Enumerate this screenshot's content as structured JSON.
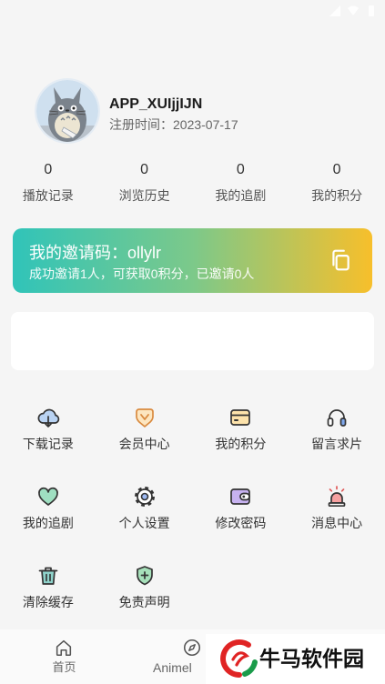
{
  "colors": {
    "background": "#f5f5f5",
    "card": "#ffffff",
    "text_primary": "#222222",
    "text_secondary": "#666666",
    "invite_gradient_start": "#30c4b9",
    "invite_gradient_end": "#f7bf2b",
    "nav_background": "#fafafa"
  },
  "status_bar": {
    "icons": [
      "signal-icon",
      "wifi-icon",
      "battery-icon"
    ]
  },
  "profile": {
    "avatar": "totoro-avatar",
    "username": "APP_XUIjjIJN",
    "register_time": "注册时间：2023-07-17"
  },
  "stats": [
    {
      "value": 0,
      "label": "播放记录"
    },
    {
      "value": 0,
      "label": "浏览历史"
    },
    {
      "value": 0,
      "label": "我的追剧"
    },
    {
      "value": 0,
      "label": "我的积分"
    }
  ],
  "invite": {
    "title": "我的邀请码：ollylr",
    "subtitle": "成功邀请1人，可获取0积分，已邀请0人",
    "icon": "copy-icon"
  },
  "menu": [
    {
      "label": "下载记录",
      "icon": "cloud-download-icon"
    },
    {
      "label": "会员中心",
      "icon": "vip-badge-icon"
    },
    {
      "label": "我的积分",
      "icon": "points-card-icon"
    },
    {
      "label": "留言求片",
      "icon": "headphones-icon"
    },
    {
      "label": "我的追剧",
      "icon": "heart-icon"
    },
    {
      "label": "个人设置",
      "icon": "gear-icon"
    },
    {
      "label": "修改密码",
      "icon": "wallet-icon"
    },
    {
      "label": "消息中心",
      "icon": "alarm-icon"
    },
    {
      "label": "清除缓存",
      "icon": "trash-icon"
    },
    {
      "label": "免责声明",
      "icon": "shield-plus-icon"
    }
  ],
  "bottom_nav": [
    {
      "label": "首页",
      "icon": "home-icon"
    },
    {
      "label": "Animel",
      "icon": "compass-icon"
    }
  ],
  "watermark": {
    "text": "牛马软件园",
    "logo": "watermark-logo-icon"
  }
}
